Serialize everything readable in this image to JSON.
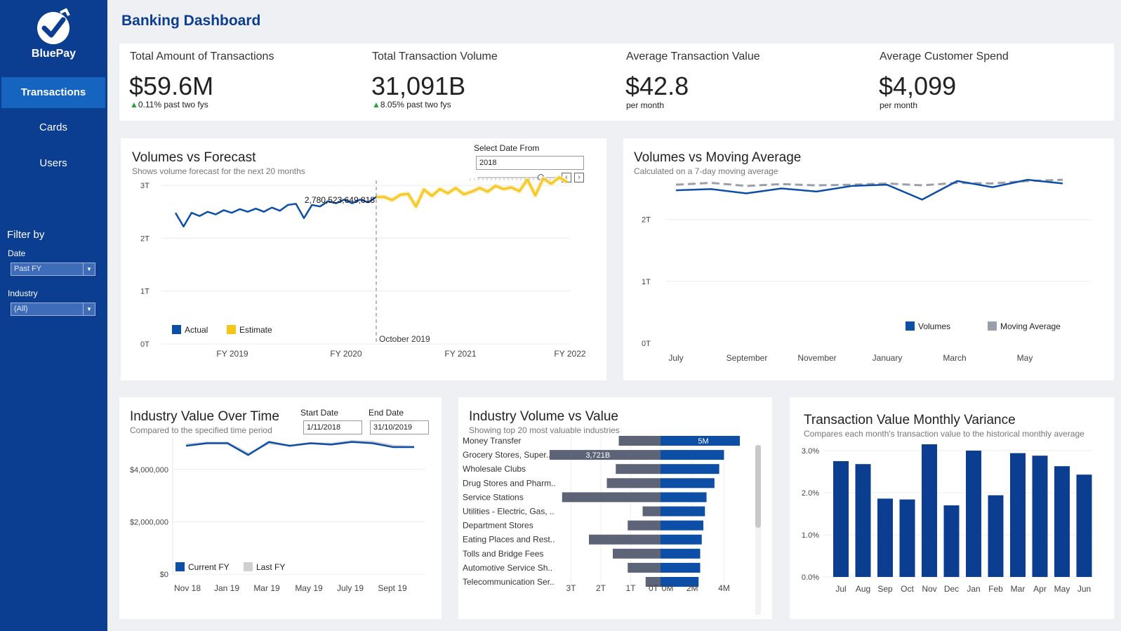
{
  "app": {
    "logo_text": "BluePay",
    "title": "Banking Dashboard"
  },
  "nav": {
    "items": [
      "Transactions",
      "Cards",
      "Users"
    ],
    "active": "Transactions"
  },
  "filters": {
    "title": "Filter by",
    "date_label": "Date",
    "date_value": "Past FY",
    "industry_label": "Industry",
    "industry_value": "(All)"
  },
  "kpis": [
    {
      "label": "Total Amount of Transactions",
      "value": "$59.6M",
      "delta": "0.11% past two fys",
      "arrow": "▲"
    },
    {
      "label": "Total Transaction Volume",
      "value": "31,091B",
      "delta": "8.05% past two fys",
      "arrow": "▲"
    },
    {
      "label": "Average Transaction Value",
      "value": "$42.8",
      "sub": "per month"
    },
    {
      "label": "Average Customer Spend",
      "value": "$4,099",
      "sub": "per month"
    }
  ],
  "colors": {
    "sidebar": "#0b3d91",
    "active_nav": "#1565c0",
    "primary": "#0d4ea6",
    "estimate": "#f5c518",
    "moving_avg": "#9a9fac",
    "value_bar": "#5d6478",
    "variance_bar": "#0b3d91"
  },
  "volumes_forecast": {
    "title": "Volumes vs Forecast",
    "subtitle": "Shows volume forecast for the next 20 months",
    "control_label": "Select Date From",
    "control_value": "2018",
    "y_ticks": [
      "0T",
      "1T",
      "2T",
      "3T"
    ],
    "x_ticks": [
      "FY 2019",
      "FY 2020",
      "FY 2021",
      "FY 2022"
    ],
    "marker_label": "2,780,523,649,818",
    "divider_label": "October 2019",
    "legend": [
      "Actual",
      "Estimate"
    ],
    "chart_data": {
      "type": "line",
      "ylim": [
        0,
        3.2
      ],
      "unit": "T",
      "series": [
        {
          "name": "Actual",
          "values": [
            2.48,
            2.22,
            2.48,
            2.42,
            2.5,
            2.45,
            2.53,
            2.48,
            2.55,
            2.5,
            2.56,
            2.5,
            2.58,
            2.52,
            2.63,
            2.65,
            2.38,
            2.63,
            2.6,
            2.7,
            2.66,
            2.73,
            2.66,
            2.73,
            2.68,
            2.78
          ]
        },
        {
          "name": "Estimate",
          "values": [
            2.78,
            2.72,
            2.82,
            2.84,
            2.6,
            2.92,
            2.8,
            2.93,
            2.85,
            2.95,
            2.83,
            2.88,
            2.95,
            2.88,
            2.99,
            2.93,
            2.96,
            2.89,
            3.11,
            2.81,
            3.13,
            3.03,
            3.15,
            3.06
          ]
        }
      ]
    }
  },
  "moving_average": {
    "title": "Volumes vs Moving Average",
    "subtitle": "Calculated on a 7-day moving average",
    "y_ticks": [
      "0T",
      "1T",
      "2T"
    ],
    "x_ticks": [
      "July",
      "September",
      "November",
      "January",
      "March",
      "May"
    ],
    "legend": [
      "Volumes",
      "Moving Average"
    ],
    "chart_data": {
      "type": "line",
      "ylim": [
        0,
        2.8
      ],
      "unit": "T",
      "categories": [
        "Jul",
        "Aug",
        "Sep",
        "Oct",
        "Nov",
        "Dec",
        "Jan",
        "Feb",
        "Mar",
        "Apr",
        "May",
        "Jun"
      ],
      "series": [
        {
          "name": "Volumes",
          "values": [
            2.47,
            2.49,
            2.42,
            2.5,
            2.45,
            2.54,
            2.56,
            2.32,
            2.62,
            2.52,
            2.64,
            2.58
          ]
        },
        {
          "name": "Moving Average",
          "values": [
            2.56,
            2.59,
            2.54,
            2.57,
            2.55,
            2.56,
            2.58,
            2.55,
            2.59,
            2.58,
            2.62,
            2.64
          ]
        }
      ]
    }
  },
  "industry_value": {
    "title": "Industry Value Over Time",
    "subtitle": "Compared to the specified time period",
    "start_label": "Start Date",
    "start_value": "1/11/2018",
    "end_label": "End Date",
    "end_value": "31/10/2019",
    "y_ticks": [
      "$0",
      "$2,000,000",
      "$4,000,000"
    ],
    "x_ticks": [
      "Nov 18",
      "Jan 19",
      "Mar 19",
      "May 19",
      "July 19",
      "Sept 19"
    ],
    "legend": [
      "Current FY",
      "Last FY"
    ],
    "chart_data": {
      "type": "line",
      "ylim": [
        0,
        5200000
      ],
      "categories": [
        "Nov 18",
        "Dec 18",
        "Jan 19",
        "Feb 19",
        "Mar 19",
        "Apr 19",
        "May 19",
        "Jun 19",
        "Jul 19",
        "Aug 19",
        "Sep 19",
        "Oct 19"
      ],
      "series": [
        {
          "name": "Current FY",
          "values": [
            4900000,
            5000000,
            5000000,
            4550000,
            5050000,
            4900000,
            5000000,
            4950000,
            5050000,
            5000000,
            4850000,
            4850000
          ]
        },
        {
          "name": "Last FY",
          "values": [
            4950000,
            5020000,
            5020000,
            4600000,
            5000000,
            4920000,
            5000000,
            4980000,
            5080000,
            5050000,
            4900000,
            4860000
          ]
        }
      ]
    }
  },
  "industry_volume": {
    "title": "Industry Volume vs Value",
    "subtitle": "Showing top 20 most valuable industries",
    "left_ticks": [
      "3T",
      "2T",
      "1T",
      "0T"
    ],
    "right_ticks": [
      "0M",
      "2M",
      "4M"
    ],
    "value_label": "3,721B",
    "volume_label": "5M",
    "chart_data": {
      "type": "bar",
      "categories": [
        "Money Transfer",
        "Grocery Stores, Super..",
        "Wholesale Clubs",
        "Drug Stores and Pharm..",
        "Service Stations",
        "Utilities - Electric, Gas, ..",
        "Department Stores",
        "Eating Places and Rest..",
        "Tolls and Bridge Fees",
        "Automotive Service Sh..",
        "Telecommunication Ser.."
      ],
      "series": [
        {
          "name": "Value",
          "unit": "T",
          "values": [
            1.4,
            3.72,
            1.5,
            1.8,
            3.3,
            0.6,
            1.1,
            2.4,
            1.6,
            1.1,
            0.5
          ]
        },
        {
          "name": "Volume",
          "unit": "M",
          "values": [
            5.0,
            4.0,
            3.7,
            3.4,
            2.9,
            2.8,
            2.7,
            2.6,
            2.5,
            2.5,
            2.4
          ]
        }
      ]
    }
  },
  "variance": {
    "title": "Transaction Value Monthly Variance",
    "subtitle": "Compares each month's transaction value to the historical monthly average",
    "y_ticks": [
      "0.0%",
      "1.0%",
      "2.0%",
      "3.0%"
    ],
    "chart_data": {
      "type": "bar",
      "ylim": [
        0,
        3.3
      ],
      "unit": "%",
      "categories": [
        "Jul",
        "Aug",
        "Sep",
        "Oct",
        "Nov",
        "Dec",
        "Jan",
        "Feb",
        "Mar",
        "Apr",
        "May",
        "Jun"
      ],
      "values": [
        2.75,
        2.68,
        1.86,
        1.84,
        3.15,
        1.7,
        3.0,
        1.94,
        2.94,
        2.88,
        2.63,
        2.43
      ]
    }
  }
}
